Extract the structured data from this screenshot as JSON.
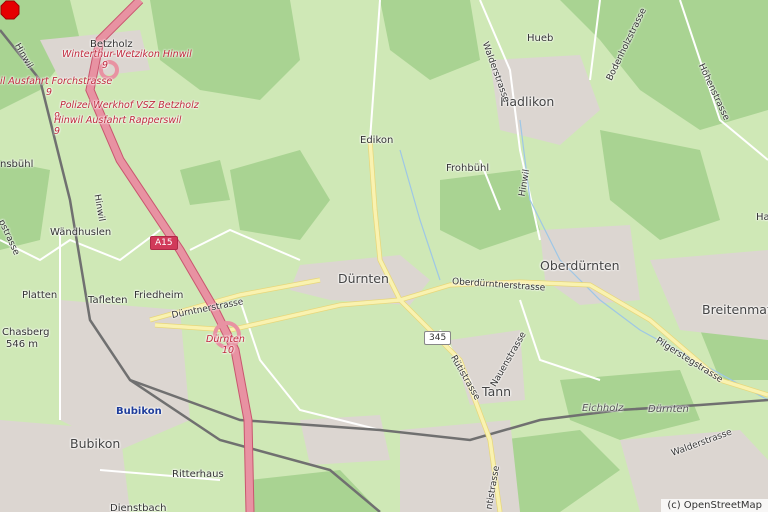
{
  "map": {
    "attribution": "(c) OpenStreetMap",
    "marker": {
      "name": "location-marker",
      "color": "#e60000"
    },
    "colors": {
      "meadow": "#cfe8b6",
      "forest": "#a9d392",
      "urban": "#dcd6d1",
      "motorway": "#e892a2",
      "primary": "#f9f2b0",
      "rail": "#707070"
    },
    "places": {
      "durnten": "Dürnten",
      "oberdurnten": "Oberdürnten",
      "hadlikon": "Hadlikon",
      "tann": "Tann",
      "bubikon": "Bubikon",
      "bubikon_station": "Bubikon",
      "breitenmatt": "Breitenmatt",
      "edikon": "Edikon",
      "frohbuhl": "Frohbühl",
      "hueb": "Hueb",
      "wandhuslen": "Wändhuslen",
      "platten": "Platten",
      "tafleten": "Tafleten",
      "friedheim": "Friedheim",
      "ritterhaus": "Ritterhaus",
      "dienstbach": "Dienstbach",
      "betzholz": "Betzholz",
      "chasberg": "Chasberg",
      "chasberg_elev": "546 m",
      "hinwil_area": "Hinwil",
      "hinwil_stream": "Hinwil",
      "eichholz": "Eichholz",
      "durnten_stream": "Dürnten",
      "nsbuhl": "nsbühl",
      "ha": "Ha"
    },
    "motorway_labels": {
      "exit_winterthur": "Winterthur-Wetzikon Hinwil",
      "exit_winterthur_no": "9",
      "forchstrasse": "il Ausfahrt Forchstrasse",
      "forchstrasse_no": "9",
      "polizei": "Polizei Werkhof VSZ Betzholz",
      "polizei_no": "9",
      "rapperswil": "Hinwil Ausfahrt Rapperswil",
      "rapperswil_no": "9",
      "exit_durnten": "Dürnten",
      "exit_durnten_no": "10"
    },
    "roads": {
      "a15": "A15",
      "r345": "345",
      "durntnerstrasse": "Dürntnerstrasse",
      "oberdurntnerstrasse": "Oberdürntnerstrasse",
      "walderstrasse": "Walderstrasse",
      "walderstrasse2": "Walderstrasse",
      "rutistrasse": "Rütistrasse",
      "nauenstrasse": "Nauenstrasse",
      "pilgerstegstrasse": "Pilgerstegstrasse",
      "bodenholzstrasse": "Bodenholzstrasse",
      "hohenstrasse": "Höhenstrasse",
      "ntistrasse": "ntistrasse",
      "pstrasse": "pstrasse",
      "hinwil_road": "Hinwil"
    }
  }
}
